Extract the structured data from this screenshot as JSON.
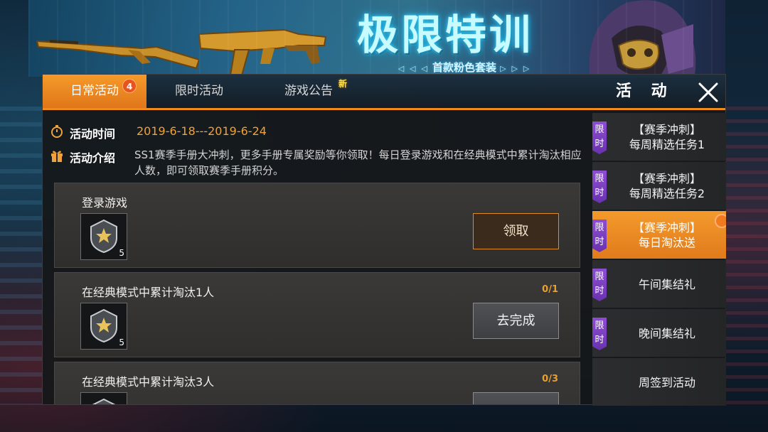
{
  "banner": {
    "title": "极限特训",
    "subtitle": "首款粉色套装",
    "arrows_left": "◁ ◁ ◁",
    "arrows_right": "▷ ▷ ▷"
  },
  "tabs": [
    {
      "label": "日常活动",
      "badge": "4",
      "active": true
    },
    {
      "label": "限时活动",
      "active": false
    },
    {
      "label": "游戏公告",
      "tag": "新",
      "active": false
    }
  ],
  "panel_title": "活 动",
  "info": {
    "time_label": "活动时间",
    "time_value": "2019-6-18---2019-6-24",
    "intro_label": "活动介绍",
    "intro_text": "SS1赛季手册大冲刺，更多手册专属奖励等你领取！每日登录游戏和在经典模式中累计淘汰相应人数，即可领取赛季手册积分。"
  },
  "tasks": [
    {
      "name": "登录游戏",
      "progress": "",
      "reward_count": "5",
      "button": "领取",
      "button_type": "claim"
    },
    {
      "name": "在经典模式中累计淘汰1人",
      "progress": "0/1",
      "reward_count": "5",
      "button": "去完成",
      "button_type": "go"
    },
    {
      "name": "在经典模式中累计淘汰3人",
      "progress": "0/3",
      "reward_count": "",
      "button": "",
      "button_type": "go"
    }
  ],
  "side_items": [
    {
      "tag": "限\n时",
      "line1": "【赛季冲刺】",
      "line2": "每周精选任务1",
      "active": false
    },
    {
      "tag": "限\n时",
      "line1": "【赛季冲刺】",
      "line2": "每周精选任务2",
      "active": false
    },
    {
      "tag": "限\n时",
      "line1": "【赛季冲刺】",
      "line2": "每日淘汰送",
      "active": true
    },
    {
      "tag": "限\n时",
      "line1": "午间集结礼",
      "line2": "",
      "active": false
    },
    {
      "tag": "限\n时",
      "line1": "晚间集结礼",
      "line2": "",
      "active": false
    },
    {
      "tag": "",
      "line1": "周签到活动",
      "line2": "",
      "active": false
    }
  ],
  "colors": {
    "accent": "#f08a1a",
    "time_value": "#f0a23a",
    "limit_tag": "#7a3ec0",
    "badge": "#e8531e"
  },
  "icons": [
    "stopwatch-icon",
    "gift-icon",
    "close-icon",
    "rank-badge-icon"
  ]
}
